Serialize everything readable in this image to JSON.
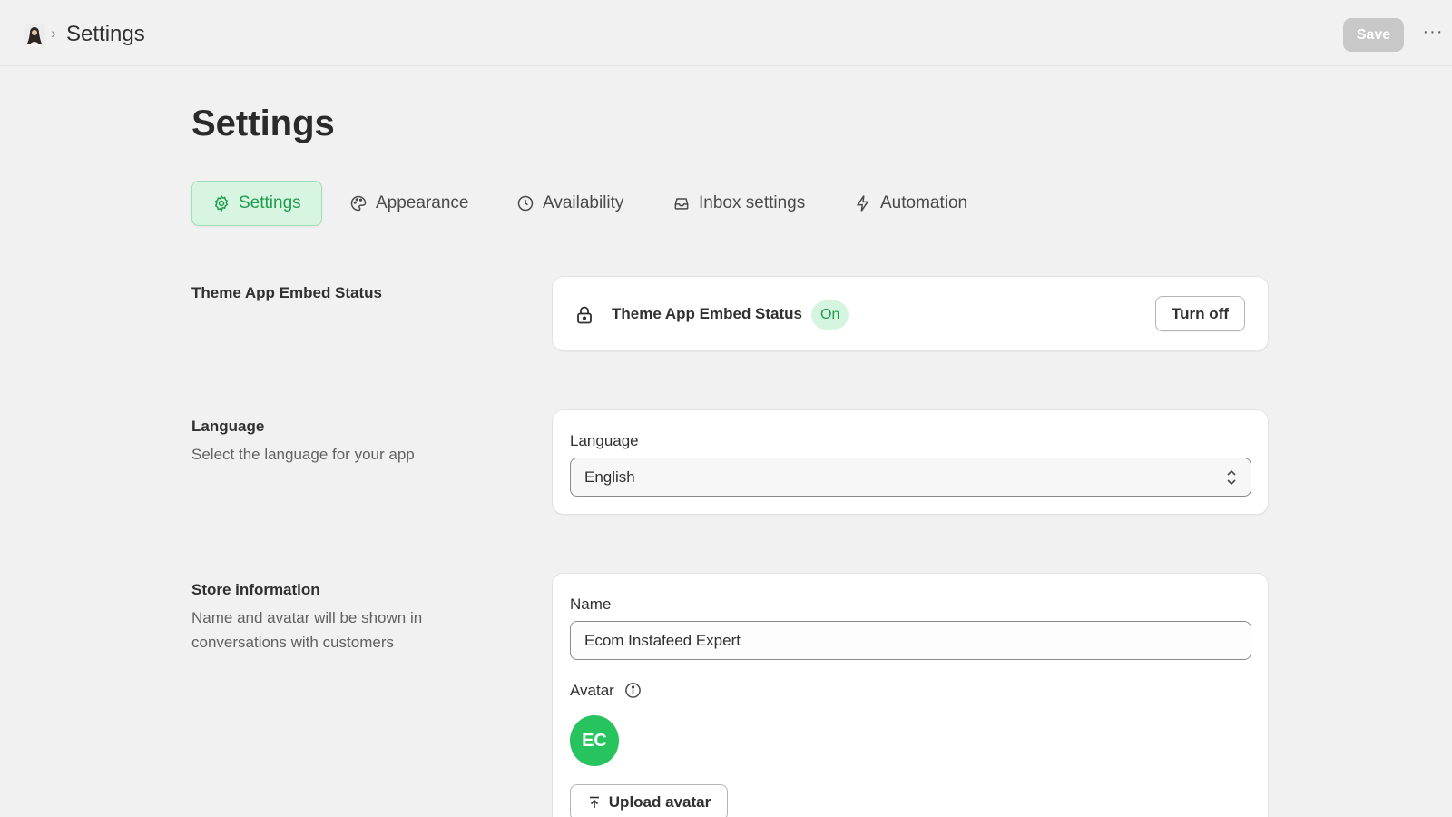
{
  "topbar": {
    "breadcrumb_separator": "›",
    "title": "Settings",
    "save_label": "Save",
    "more_label": "···"
  },
  "page": {
    "title": "Settings"
  },
  "tabs": [
    {
      "label": "Settings",
      "icon": "gear-icon",
      "active": true
    },
    {
      "label": "Appearance",
      "icon": "palette-icon",
      "active": false
    },
    {
      "label": "Availability",
      "icon": "clock-icon",
      "active": false
    },
    {
      "label": "Inbox settings",
      "icon": "inbox-icon",
      "active": false
    },
    {
      "label": "Automation",
      "icon": "lightning-icon",
      "active": false
    }
  ],
  "theme_embed": {
    "section_title": "Theme App Embed Status",
    "card_title": "Theme App Embed Status",
    "status_badge": "On",
    "toggle_button": "Turn off"
  },
  "language": {
    "section_title": "Language",
    "section_desc": "Select the language for your app",
    "field_label": "Language",
    "selected_value": "English"
  },
  "store_info": {
    "section_title": "Store information",
    "section_desc": "Name and avatar will be shown in conversations with customers",
    "name_label": "Name",
    "name_value": "Ecom Instafeed Expert",
    "avatar_label": "Avatar",
    "avatar_initials": "EC",
    "upload_button": "Upload avatar"
  },
  "colors": {
    "accent_green": "#27c35e",
    "active_tab_bg": "#d7f5e1",
    "background": "#f1f1f1"
  }
}
